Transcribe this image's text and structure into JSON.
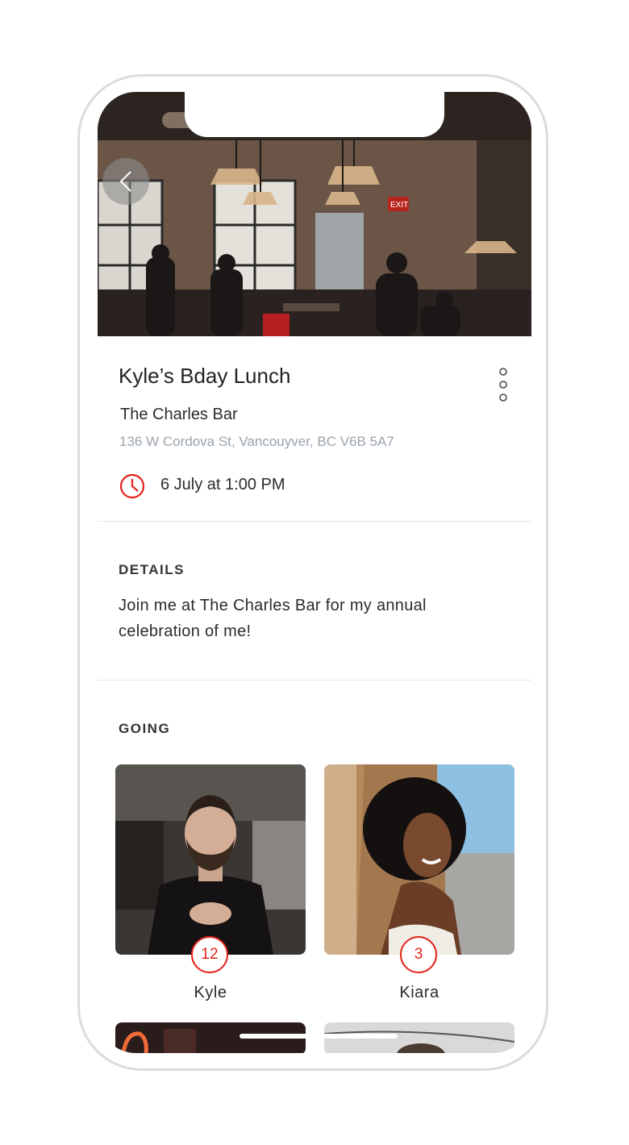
{
  "event": {
    "title": "Kyle’s Bday Lunch",
    "venue": "The Charles Bar",
    "address": "136 W Cordova St, Vancouyver, BC V6B 5A7",
    "datetime": "6 July at 1:00 PM"
  },
  "details": {
    "label": "DETAILS",
    "text": "Join me at The Charles Bar for my annual celebration of me!"
  },
  "going": {
    "label": "GOING",
    "people": [
      {
        "name": "Kyle",
        "count": "12"
      },
      {
        "name": "Kiara",
        "count": "3"
      }
    ]
  },
  "hero": {
    "exit_sign": "EXIT"
  },
  "icons": {
    "back": "chevron-left-icon",
    "more": "more-vertical-icon",
    "clock": "clock-icon"
  },
  "colors": {
    "accent": "#e2231a",
    "address": "#9aa3ad",
    "divider": "#e6e6e6"
  }
}
